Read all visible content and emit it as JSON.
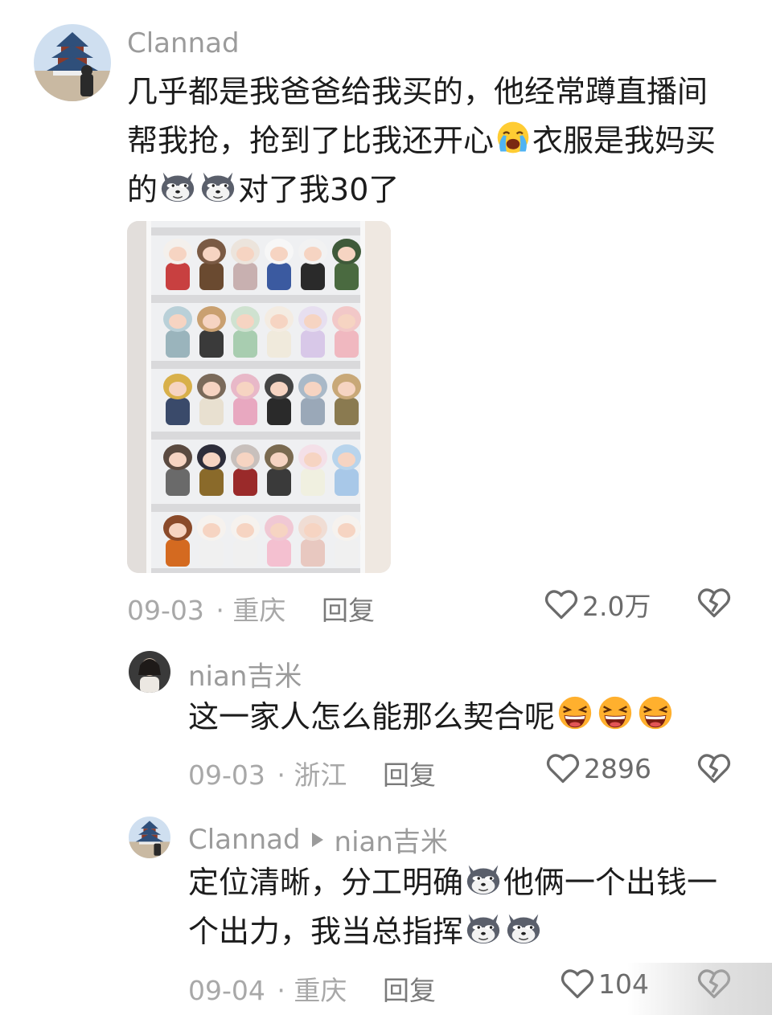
{
  "comments": [
    {
      "username": "Clannad",
      "lines": [
        "几乎都是我爸爸给我买的，他经常蹲直播间",
        "帮我抢，抢到了比我还开心",
        "衣服是我妈买",
        "的",
        "对了我30了"
      ],
      "date": "09-03",
      "location": "· 重庆",
      "reply_label": "回复",
      "likes": "2.0万"
    },
    {
      "username": "nian吉米",
      "text": "这一家人怎么能那么契合呢",
      "date": "09-03",
      "location": "· 浙江",
      "reply_label": "回复",
      "likes": "2896"
    },
    {
      "username": "Clannad",
      "reply_to": "nian吉米",
      "lines": [
        "定位清晰，分工明确",
        "他俩一个出钱一",
        "个出力，我当总指挥"
      ],
      "date": "09-04",
      "location": "· 重庆",
      "reply_label": "回复",
      "likes": "104"
    }
  ],
  "icons": {
    "like": "heart-outline-icon",
    "dislike": "broken-heart-icon",
    "reply_arrow": "triangle-right-icon",
    "emoji_cry": "crying-face-emoji",
    "emoji_wolf": "wolf-face-emoji",
    "emoji_laugh": "laughing-face-emoji"
  },
  "colors": {
    "username": "#9b9b9b",
    "meta": "#a8a8a8",
    "text": "#1c1c1c"
  }
}
